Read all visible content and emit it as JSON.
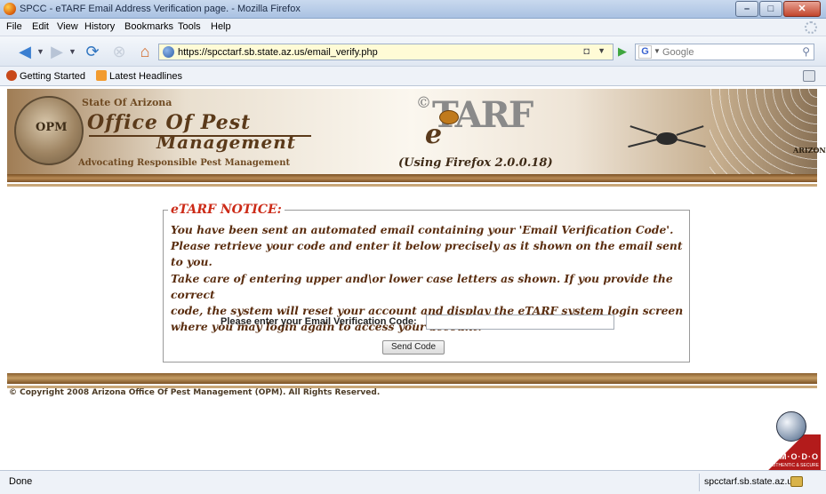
{
  "window": {
    "title": "SPCC - eTARF Email Address Verification page. - Mozilla Firefox",
    "buttons": {
      "minimize": "–",
      "maximize": "□",
      "close": "✕"
    }
  },
  "menu": [
    "File",
    "Edit",
    "View",
    "History",
    "Bookmarks",
    "Tools",
    "Help"
  ],
  "nav": {
    "url": "https://spcctarf.sb.state.az.us/email_verify.php",
    "search_placeholder": "Google",
    "search_engine_letter": "G"
  },
  "bookmarks": [
    "Getting Started",
    "Latest Headlines"
  ],
  "banner": {
    "state_text": "State Of Arizona",
    "office_line1": "Office Of Pest",
    "office_line2": "Management",
    "tagline": "Advocating Responsible Pest Management",
    "seal_text": "OPM",
    "etarf_copyright": "©",
    "etarf_word": "TARF",
    "etarf_e": "e",
    "using": "(Using Firefox 2.0.0.18)",
    "az_logo": "ARIZONA"
  },
  "notice": {
    "legend": "eTARF NOTICE:",
    "lines": [
      "You have been sent an automated email containing your 'Email Verification Code'.",
      "Please retrieve your code and enter it below precisely as it shown on the email sent to you.",
      "Take care of entering upper and\\or lower case letters as shown. If you provide the correct",
      "code, the system will reset your account and display the eTARF system login screen",
      "where you may login again to access your account."
    ],
    "verify_label": "Please enter your Email Verification Code:",
    "verify_value": "",
    "send_label": "Send Code"
  },
  "footer": {
    "copyright": "© Copyright 2008 Arizona Office Of Pest Management (OPM). All Rights Reserved.",
    "comodo_word": "C·O·M·O·D·O",
    "comodo_sub": "AUTHENTIC & SECURE"
  },
  "status": {
    "text": "Done",
    "host": "spcctarf.sb.state.az.us"
  },
  "colors": {
    "notice_title": "#cc2b18",
    "notice_text": "#5a2d0f",
    "brown_bar": "#7a5024",
    "url_bg": "#fffbd6"
  }
}
